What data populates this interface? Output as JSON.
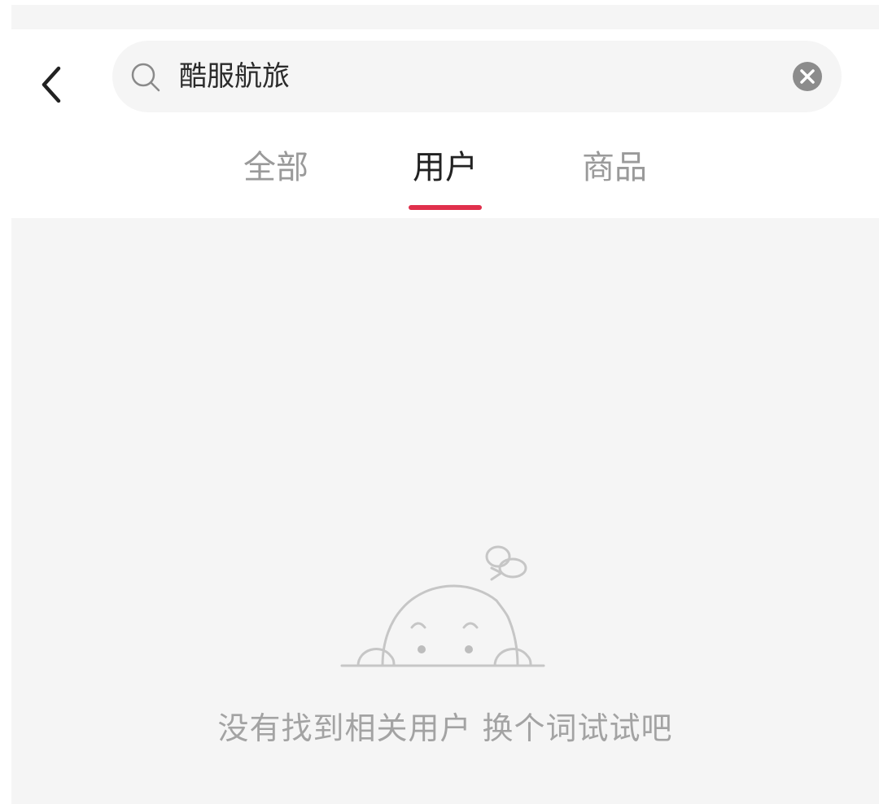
{
  "search": {
    "query": "酷服航旅",
    "icon": "search-icon",
    "clear_icon": "clear-icon"
  },
  "navigation": {
    "back_icon": "chevron-left-icon"
  },
  "tabs": [
    {
      "label": "全部",
      "active": false
    },
    {
      "label": "用户",
      "active": true
    },
    {
      "label": "商品",
      "active": false
    }
  ],
  "empty_state": {
    "illustration": "peeking-character-illustration",
    "message": "没有找到相关用户 换个词试试吧"
  },
  "colors": {
    "accent": "#e0304c",
    "background": "#f5f5f5",
    "inactive_tab": "#9a9a9a",
    "active_tab": "#222222",
    "empty_text": "#a3a3a3"
  }
}
